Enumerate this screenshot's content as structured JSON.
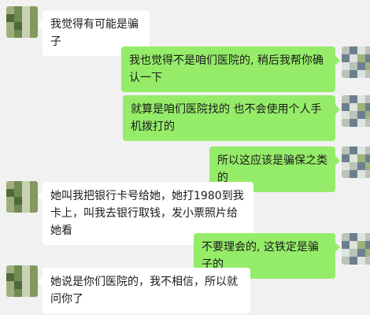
{
  "chat": {
    "messages": [
      {
        "side": "left",
        "text": "我觉得有可能是骗子"
      },
      {
        "side": "right",
        "text": "我也觉得不是咱们医院的, 稍后我帮你确认一下"
      },
      {
        "side": "right",
        "text": "就算是咱们医院找的 也不会使用个人手机拨打的"
      },
      {
        "side": "right",
        "text": "所以这应该是骗保之类的"
      },
      {
        "side": "left",
        "text": "她叫我把银行卡号给她，她打1980到我卡上，叫我去银行取钱，发小票照片给她看"
      },
      {
        "side": "right",
        "text": "不要理会的, 这铁定是骗子的"
      },
      {
        "side": "left",
        "text": "她说是你们医院的，我不相信，所以就问你了"
      }
    ]
  },
  "colors": {
    "background": "#f1f1f1",
    "bubble_left": "#ffffff",
    "bubble_right": "#95ec69"
  },
  "icons": {
    "contact_avatar": "contact-avatar-pixelated",
    "self_avatar": "self-avatar-pixelated"
  }
}
